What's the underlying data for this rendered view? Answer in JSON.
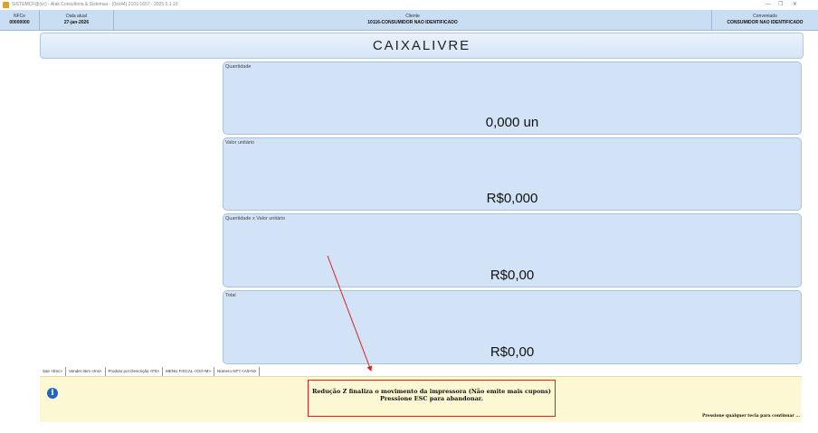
{
  "window": {
    "title": "SISTEMCF@(vc) - Atak Consultoria & Sistemas - (0xx44) 2101-1657 - 2025.5.1.10",
    "minimize": "—",
    "restore": "❐",
    "close": "✕"
  },
  "info": {
    "nfce_label": "NFCe",
    "nfce_value": "00000000",
    "date_label": "Data atual",
    "date_value": "27-jan-2026",
    "client_label": "Cliente",
    "client_value": "10116-CONSUMIDOR  NAO  IDENTIFICADO",
    "agreement_label": "Conveniado",
    "agreement_value": "CONSUMIDOR  NAO  IDENTIFICADO"
  },
  "status": "CAIXALIVRE",
  "panels": [
    {
      "label": "Quantidade",
      "value": "0,000 un"
    },
    {
      "label": "Valor unitário",
      "value": "R$0,000"
    },
    {
      "label": "Quantidade x Valor unitário",
      "value": "R$0,00"
    },
    {
      "label": "Total",
      "value": "R$0,00"
    }
  ],
  "shortcuts": [
    "Sair <Esc>",
    "Vender item <Ins>",
    "Produto por Descrição <F9>",
    "MENU FISCAL <Ctrl+M>",
    "Número NF? <Alt+N>"
  ],
  "message": {
    "line1": "Redução Z finaliza o movimento da impressora (Não emite mais cupons)",
    "line2": "Pressione ESC para abandonar.",
    "continue": "Pressione qualquer tecla para continuar ...",
    "icon": "info-icon"
  },
  "colors": {
    "panel": "#d2e3f7",
    "message_bg": "#fdf8d4",
    "annotation": "#e02020"
  }
}
